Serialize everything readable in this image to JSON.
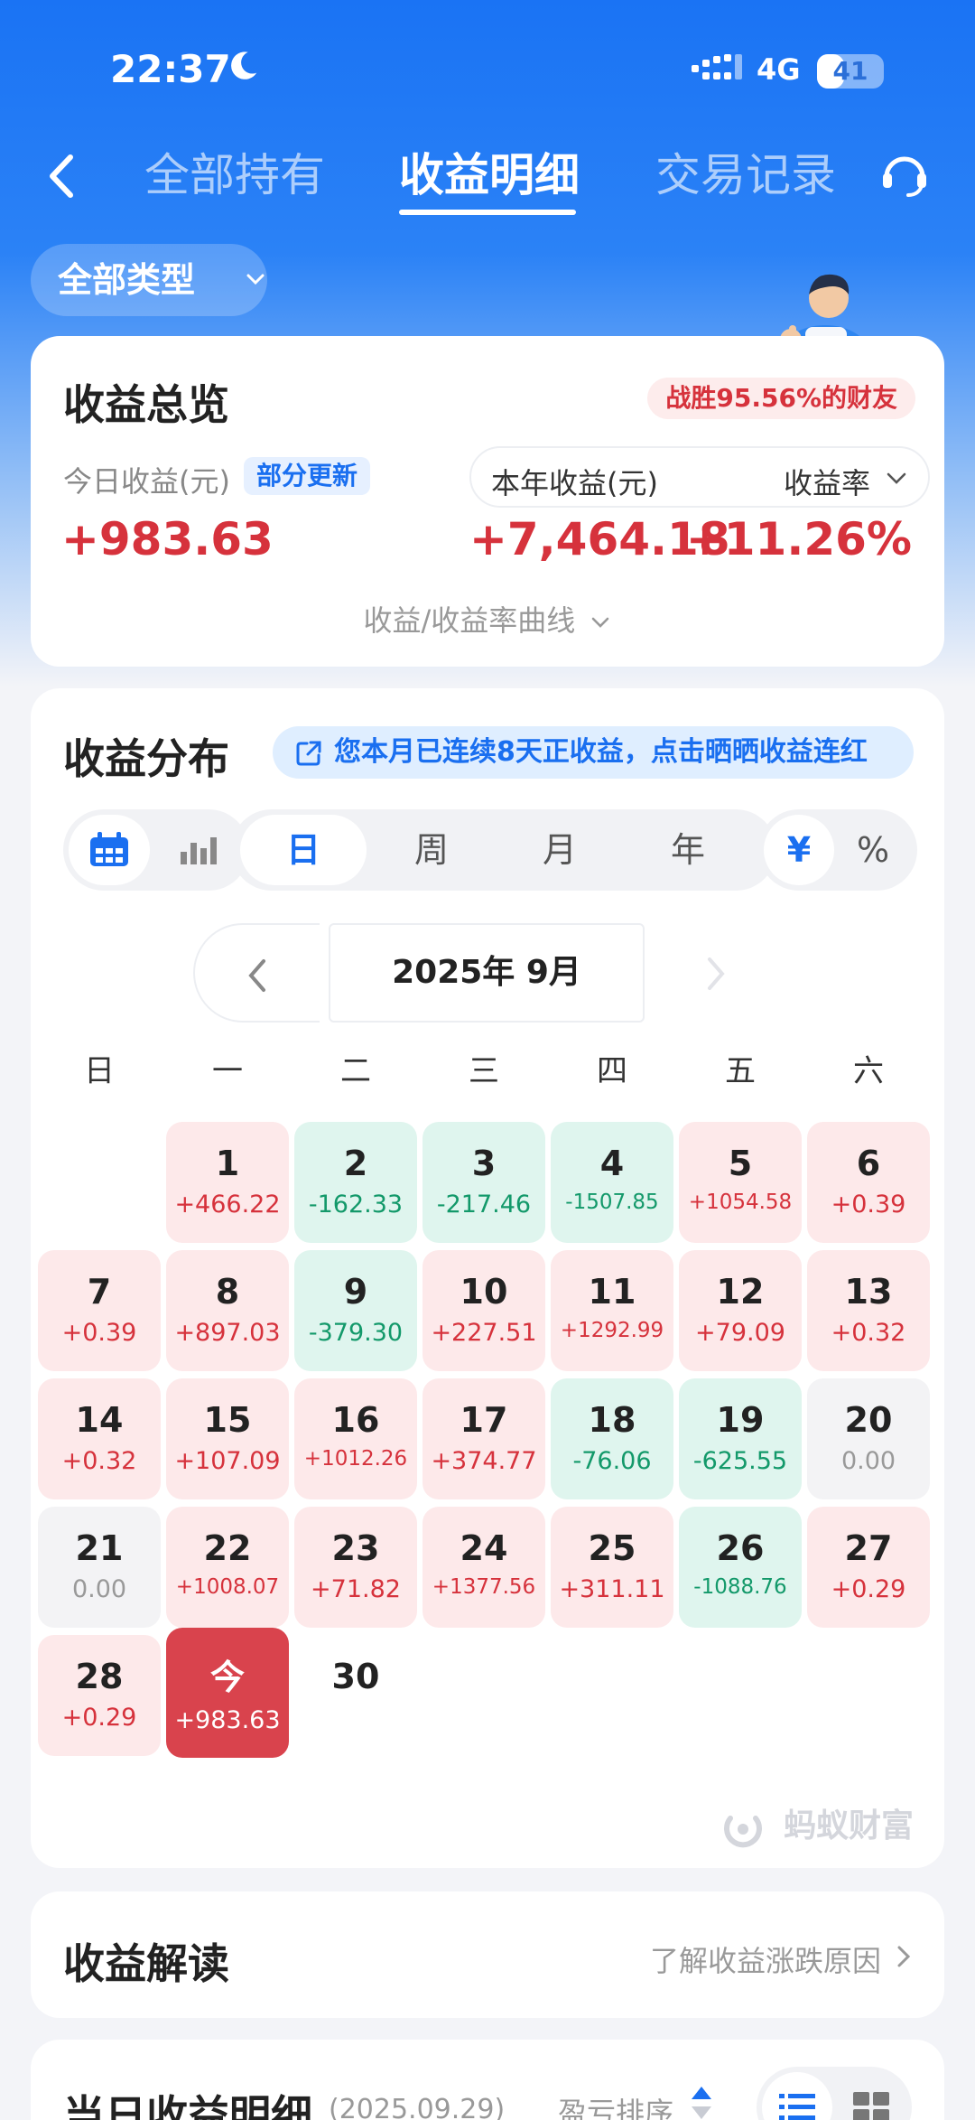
{
  "status_bar": {
    "time": "22:37",
    "network": "4G",
    "battery": "41",
    "battery_level": 0.41
  },
  "nav": {
    "tabs": [
      {
        "label": "全部持有",
        "active": false
      },
      {
        "label": "收益明细",
        "active": true
      },
      {
        "label": "交易记录",
        "active": false
      }
    ]
  },
  "filter": {
    "label": "全部类型"
  },
  "overview": {
    "title": "收益总览",
    "beat_badge": "战胜95.56%的财友",
    "today_label": "今日收益(元)",
    "update_badge": "部分更新",
    "today_value": "+983.63",
    "year_label": "本年收益(元)",
    "rate_label": "收益率",
    "year_value": "+7,464.18",
    "rate_value": "+11.26%",
    "curve_link": "收益/收益率曲线"
  },
  "distribution": {
    "title": "收益分布",
    "streak_banner": "您本月已连续8天正收益，点击晒晒收益连红",
    "periods": [
      "日",
      "周",
      "月",
      "年"
    ],
    "active_period": "日",
    "units": [
      "¥",
      "%"
    ],
    "active_unit": "¥",
    "month_label": "2025年 9月",
    "weekdays": [
      "日",
      "一",
      "二",
      "三",
      "四",
      "五",
      "六"
    ],
    "days": [
      {
        "day": "1",
        "value": "+466.22",
        "kind": "pos"
      },
      {
        "day": "2",
        "value": "-162.33",
        "kind": "neg"
      },
      {
        "day": "3",
        "value": "-217.46",
        "kind": "neg"
      },
      {
        "day": "4",
        "value": "-1507.85",
        "kind": "neg"
      },
      {
        "day": "5",
        "value": "+1054.58",
        "kind": "pos"
      },
      {
        "day": "6",
        "value": "+0.39",
        "kind": "pos"
      },
      {
        "day": "7",
        "value": "+0.39",
        "kind": "pos"
      },
      {
        "day": "8",
        "value": "+897.03",
        "kind": "pos"
      },
      {
        "day": "9",
        "value": "-379.30",
        "kind": "neg"
      },
      {
        "day": "10",
        "value": "+227.51",
        "kind": "pos"
      },
      {
        "day": "11",
        "value": "+1292.99",
        "kind": "pos"
      },
      {
        "day": "12",
        "value": "+79.09",
        "kind": "pos"
      },
      {
        "day": "13",
        "value": "+0.32",
        "kind": "pos"
      },
      {
        "day": "14",
        "value": "+0.32",
        "kind": "pos"
      },
      {
        "day": "15",
        "value": "+107.09",
        "kind": "pos"
      },
      {
        "day": "16",
        "value": "+1012.26",
        "kind": "pos"
      },
      {
        "day": "17",
        "value": "+374.77",
        "kind": "pos"
      },
      {
        "day": "18",
        "value": "-76.06",
        "kind": "neg"
      },
      {
        "day": "19",
        "value": "-625.55",
        "kind": "neg"
      },
      {
        "day": "20",
        "value": "0.00",
        "kind": "zero"
      },
      {
        "day": "21",
        "value": "0.00",
        "kind": "zero"
      },
      {
        "day": "22",
        "value": "+1008.07",
        "kind": "pos"
      },
      {
        "day": "23",
        "value": "+71.82",
        "kind": "pos"
      },
      {
        "day": "24",
        "value": "+1377.56",
        "kind": "pos"
      },
      {
        "day": "25",
        "value": "+311.11",
        "kind": "pos"
      },
      {
        "day": "26",
        "value": "-1088.76",
        "kind": "neg"
      },
      {
        "day": "27",
        "value": "+0.29",
        "kind": "pos"
      },
      {
        "day": "28",
        "value": "+0.29",
        "kind": "pos"
      },
      {
        "day": "今",
        "value": "+983.63",
        "kind": "today"
      },
      {
        "day": "30",
        "value": "",
        "kind": "empty"
      }
    ],
    "watermark": "蚂蚁财富"
  },
  "interpretation": {
    "title": "收益解读",
    "link": "了解收益涨跌原因"
  },
  "detail": {
    "title": "当日收益明细",
    "date": "(2025.09.29)",
    "sort_label": "盈亏排序"
  },
  "colors": {
    "brand_blue": "#1a73f4",
    "gain_red": "#d6323c",
    "loss_green": "#13996a"
  }
}
